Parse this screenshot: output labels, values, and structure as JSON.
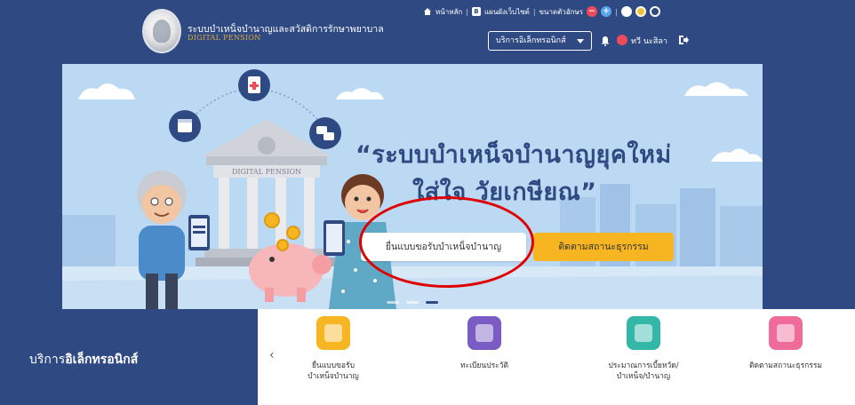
{
  "header": {
    "site_title": "ระบบบำเหน็จบำนาญและสวัสดิการรักษาพยาบาล",
    "site_subtitle": "DIGITAL PENSION",
    "top_links": {
      "home": "หน้าหลัก",
      "sitemap": "แผนผังเว็บไซต์",
      "font_size": "ขนาดตัวอักษร"
    },
    "service_select": "บริการอิเล็กทรอนิกส์",
    "user_name": "ทวี นะสิลา",
    "colors": {
      "header_bg": "#2f4a82",
      "accent_gold": "#e0a93a"
    }
  },
  "banner": {
    "headline_line1": "“ระบบบำเหน็จบำนาญยุคใหม่",
    "headline_line2": "ใส่ใจ วัยเกษียณ”",
    "bank_sign": "DIGITAL PENSION",
    "apply_button": "ยื่นแบบขอรับบำเหน็จบำนาญ",
    "track_button": "ติดตามสถานะธุรกรรม",
    "colors": {
      "background": "#bcd9f3",
      "track_button": "#f6b521",
      "annotation_ring": "#e00000"
    }
  },
  "services": {
    "heading_part1": "บริการ",
    "heading_part2": "อิเล็กทรอนิกส์",
    "items": [
      {
        "label": "ยื่นแบบขอรับ\nบำเหน็จบำนาญ",
        "color": "#f6b521",
        "icon": "document-form-icon"
      },
      {
        "label": "ทะเบียนประวัติ",
        "color": "#7b5cc4",
        "icon": "profile-search-icon"
      },
      {
        "label": "ประมาณการเบี้ยหวัด/\nบำเหน็จ/บำนาญ",
        "color": "#33b8a8",
        "icon": "chart-calculator-icon"
      },
      {
        "label": "ติดตามสถานะธุรกรรม",
        "color": "#ef6b9a",
        "icon": "checklist-icon"
      }
    ]
  }
}
